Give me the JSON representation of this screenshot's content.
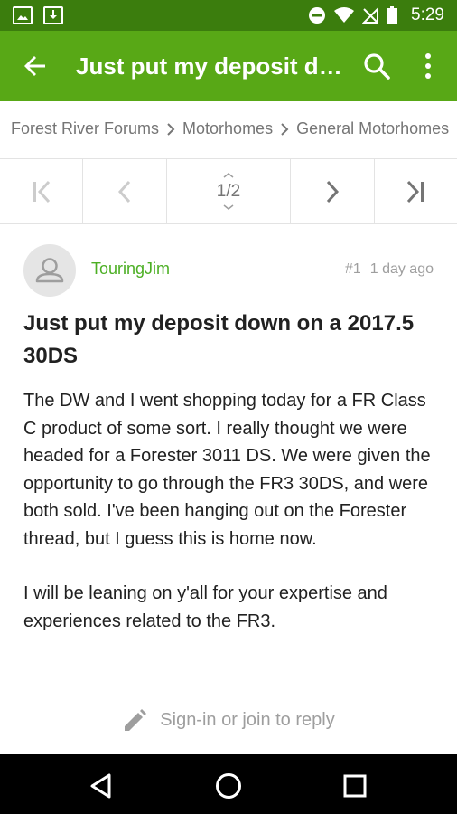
{
  "status_bar": {
    "time": "5:29",
    "icons": [
      "image-notification-icon",
      "download-notification-icon",
      "do-not-disturb-icon",
      "wifi-icon",
      "no-signal-icon",
      "battery-icon"
    ]
  },
  "app_bar": {
    "title": "Just put my deposit down on a 2017.5 30DS",
    "icons": [
      "back-arrow-icon",
      "search-icon",
      "more-vert-icon"
    ],
    "background": "#58a816",
    "status_background": "#3b7d0d"
  },
  "breadcrumb": {
    "items": [
      "Forest River Forums",
      "Motorhomes",
      "General Motorhomes"
    ]
  },
  "pager": {
    "current_page": "1",
    "total_pages": "2",
    "icons": [
      "first-page-icon",
      "previous-page-icon",
      "page-selector-icon",
      "next-page-icon",
      "last-page-icon"
    ]
  },
  "post": {
    "author": "TouringJim",
    "number": "#1",
    "time_ago": "1 day ago",
    "title": "Just put my deposit down on a 2017.5 30DS",
    "paragraphs": [
      "The DW and I went shopping today for a FR Class C product of some sort. I really thought we were headed for a Forester 3011 DS. We were given the opportunity to go through the FR3 30DS, and were both sold. I've been hanging out on the Forester thread, but I guess this is home now.",
      "I will be leaning on y'all for your expertise and experiences related to the FR3."
    ],
    "author_color": "#4caf24"
  },
  "reply": {
    "label": "Sign-in or join to reply"
  },
  "nav_bar": {
    "icons": [
      "back-triangle-icon",
      "home-circle-icon",
      "recents-square-icon"
    ]
  }
}
